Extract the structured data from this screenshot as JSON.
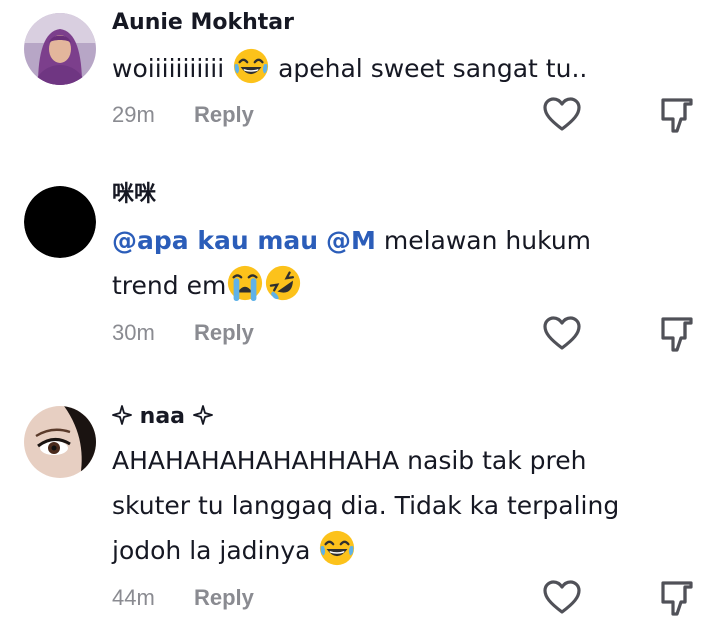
{
  "comments": [
    {
      "username": "Aunie Mokhtar",
      "text_1": "woiiiiiiiiiii",
      "text_2": "apehal sweet sangat tu..",
      "emoji": "joy-emoji",
      "time": "29m",
      "reply_label": "Reply"
    },
    {
      "username": "咪咪",
      "mention_1": "@apa kau mau",
      "mention_2": "@M",
      "text_1": "melawan hukum",
      "text_2": "trend em",
      "emojis": [
        "loudly-crying-emoji",
        "rofl-emoji"
      ],
      "time": "30m",
      "reply_label": "Reply"
    },
    {
      "username": "naa",
      "username_decoration": "sparkle-icon",
      "text_1": "AHAHAHAHAHAHHAHA nasib tak preh",
      "text_2": "skuter tu langgaq dia. Tidak ka terpaling",
      "text_3": "jodoh la jadinya",
      "emoji": "joy-emoji",
      "time": "44m",
      "reply_label": "Reply"
    }
  ],
  "icons": {
    "like": "heart-outline-icon",
    "dislike": "thumbs-down-outline-icon"
  },
  "colors": {
    "text": "#161823",
    "meta": "#8a8b91",
    "mention": "#2b5db9",
    "icon": "#505158"
  }
}
